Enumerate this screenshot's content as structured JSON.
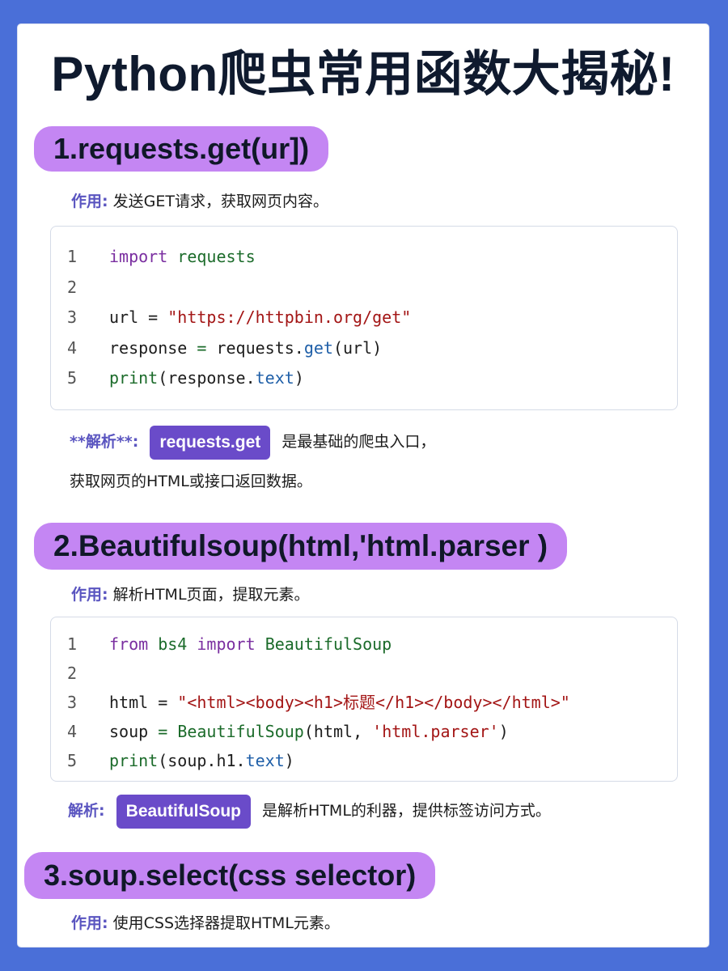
{
  "title": "Python爬虫常用函数大揭秘!",
  "sections": [
    {
      "heading": "1.requests.get(ur])",
      "purpose_label": "作用:",
      "purpose_text": "发送GET请求，获取网页内容。",
      "code_lines": [
        {
          "n": "1",
          "tokens": [
            [
              "kw",
              "import"
            ],
            [
              "plain",
              " "
            ],
            [
              "mod",
              "requests"
            ]
          ]
        },
        {
          "n": "2",
          "tokens": []
        },
        {
          "n": "3",
          "tokens": [
            [
              "plain",
              "url = "
            ],
            [
              "str",
              "\"https://httpbin.org/get\""
            ]
          ]
        },
        {
          "n": "4",
          "tokens": [
            [
              "plain",
              "response "
            ],
            [
              "op",
              "="
            ],
            [
              "plain",
              " requests."
            ],
            [
              "attr",
              "get"
            ],
            [
              "plain",
              "(url)"
            ]
          ]
        },
        {
          "n": "5",
          "tokens": [
            [
              "fn",
              "print"
            ],
            [
              "plain",
              "(response."
            ],
            [
              "attr",
              "text"
            ],
            [
              "plain",
              ")"
            ]
          ]
        }
      ],
      "analysis_label": "**解析**:",
      "analysis_pill": "requests.get",
      "analysis_text": "是最基础的爬虫入口，",
      "analysis_text2": "获取网页的HTML或接口返回数据。"
    },
    {
      "heading": "2.Beautifulsoup(html,'html.parser )",
      "purpose_label": "作用:",
      "purpose_text": "解析HTML页面，提取元素。",
      "code_lines": [
        {
          "n": "1",
          "tokens": [
            [
              "kw",
              "from"
            ],
            [
              "plain",
              " "
            ],
            [
              "mod",
              "bs4"
            ],
            [
              "plain",
              " "
            ],
            [
              "kw",
              "import"
            ],
            [
              "plain",
              " "
            ],
            [
              "cls",
              "BeautifulSoup"
            ]
          ]
        },
        {
          "n": "2",
          "tokens": []
        },
        {
          "n": "3",
          "tokens": [
            [
              "plain",
              "html = "
            ],
            [
              "str",
              "\"<html><body><h1>标题</h1></body></html>\""
            ]
          ]
        },
        {
          "n": "4",
          "tokens": [
            [
              "plain",
              "soup "
            ],
            [
              "op",
              "="
            ],
            [
              "plain",
              " "
            ],
            [
              "cls",
              "BeautifulSoup"
            ],
            [
              "plain",
              "(html, "
            ],
            [
              "str",
              "'html.parser'"
            ],
            [
              "plain",
              ")"
            ]
          ]
        },
        {
          "n": "5",
          "tokens": [
            [
              "fn",
              "print"
            ],
            [
              "plain",
              "(soup.h1."
            ],
            [
              "attr",
              "text"
            ],
            [
              "plain",
              ")"
            ]
          ]
        }
      ],
      "analysis_label": "解析:",
      "analysis_pill": "BeautifulSoup",
      "analysis_text": "是解析HTML的利器，提供标签访问方式。"
    },
    {
      "heading": "3.soup.select(css selector)",
      "purpose_label": "作用:",
      "purpose_text": "使用CSS选择器提取HTML元素。"
    }
  ],
  "colors": {
    "frame": "#4a6fd8",
    "heading_bg": "#c486f3",
    "pill_bg": "#6a4bc9",
    "label": "#5a55c0"
  }
}
